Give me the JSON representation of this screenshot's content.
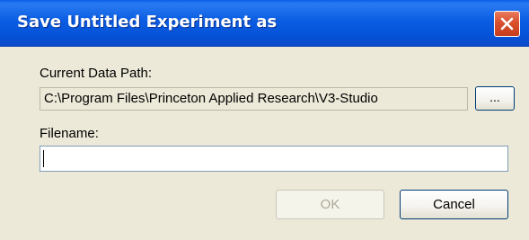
{
  "window": {
    "title": "Save Untitled Experiment as",
    "close_icon": "close-x-icon"
  },
  "data_path": {
    "label": "Current Data Path:",
    "value": "C:\\Program Files\\Princeton Applied Research\\V3-Studio",
    "browse_label": "..."
  },
  "filename": {
    "label": "Filename:",
    "value": "",
    "placeholder": ""
  },
  "buttons": {
    "ok_label": "OK",
    "ok_enabled": false,
    "cancel_label": "Cancel"
  },
  "colors": {
    "titlebar": "#0553D8",
    "dialog_bg": "#ECE9D8",
    "close_button": "#D9502E",
    "disabled_text": "#ACA899"
  }
}
